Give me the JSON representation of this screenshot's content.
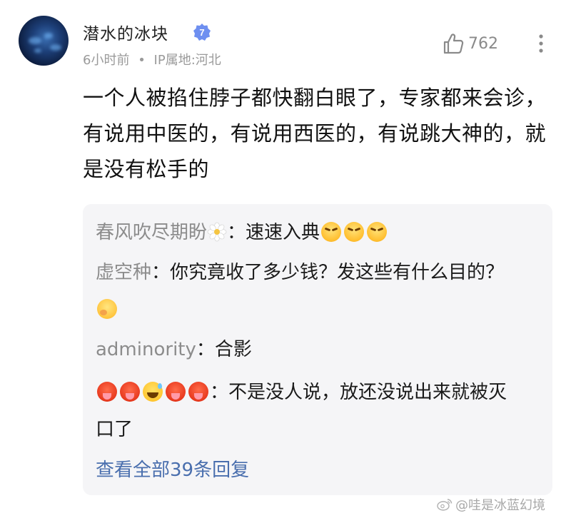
{
  "post": {
    "username": "潜水的冰块",
    "level_badge": "7",
    "time": "6小时前",
    "separator": "•",
    "ip_location": "IP属地:河北",
    "like_count": "762",
    "content": "一个人被掐住脖子都快翻白眼了，专家都来会诊，有说用中医的，有说用西医的，有说跳大神的，就是没有松手的"
  },
  "replies": [
    {
      "username": "春风吹尽期盼",
      "colon": "：",
      "text": "速速入典",
      "emojis": [
        "flower-icon",
        "angry-emoji",
        "angry-emoji",
        "angry-emoji"
      ]
    },
    {
      "username": "虚空种",
      "colon": "：",
      "text": "你究竟收了多少钱？发这些有什么目的？",
      "emojis": [
        "hmm-emoji"
      ]
    },
    {
      "username": "adminority",
      "colon": "：",
      "text": "合影"
    },
    {
      "colon": "：",
      "text": "不是没人说，放还没说出来就被灭口了",
      "emojis": [
        "hot-face-emoji",
        "hot-face-emoji",
        "sweat-smile-emoji",
        "hot-face-emoji",
        "hot-face-emoji"
      ]
    }
  ],
  "view_all_replies": "查看全部39条回复",
  "watermark": {
    "icon": "weibo-icon",
    "text": "@哇是冰蓝幻境"
  },
  "colors": {
    "link": "#4a6fae",
    "muted": "#9a9a9a",
    "reply_bg": "#f5f5f7",
    "verify_badge": "#6e8ff0"
  }
}
